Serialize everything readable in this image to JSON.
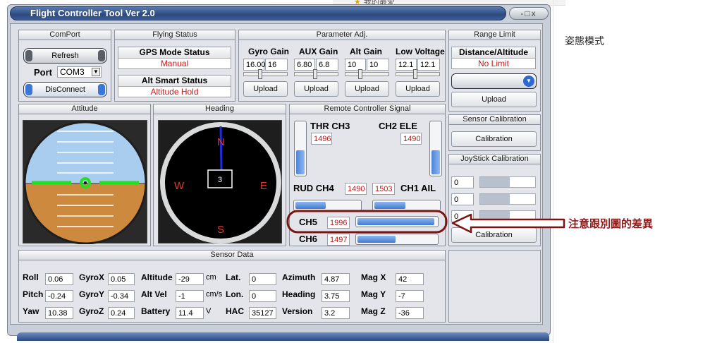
{
  "window": {
    "title": "Flight Controller Tool  Ver 2.0",
    "controls": "-□x"
  },
  "comport": {
    "header": "ComPort",
    "refresh_label": "Refresh",
    "port_label": "Port",
    "port_value": "COM3",
    "disconnect_label": "DisConnect"
  },
  "flying_status": {
    "header": "Flying Status",
    "gps_title": "GPS Mode Status",
    "gps_value": "Manual",
    "alt_title": "Alt Smart Status",
    "alt_value": "Altitude Hold"
  },
  "param": {
    "header": "Parameter Adj.",
    "groups": [
      {
        "label": "Gyro Gain",
        "v1": "16.00",
        "v2": "16",
        "upload": "Upload"
      },
      {
        "label": "AUX Gain",
        "v1": "6.80",
        "v2": "6.8",
        "upload": "Upload"
      },
      {
        "label": "Alt Gain",
        "v1": "10",
        "v2": "10",
        "upload": "Upload"
      },
      {
        "label": "Low Voltage",
        "v1": "12.1",
        "v2": "12.1",
        "upload": "Upload"
      }
    ]
  },
  "range": {
    "header": "Range Limit",
    "title": "Distance/Altitude",
    "value": "No Limit",
    "upload": "Upload"
  },
  "attitude": {
    "header": "Attitude"
  },
  "heading": {
    "header": "Heading",
    "n": "N",
    "e": "E",
    "s": "S",
    "w": "W",
    "value": "3"
  },
  "rc": {
    "header": "Remote Controller Signal",
    "thr_label": "THR CH3",
    "thr_value": "1496",
    "thr_level": 0.5,
    "ele_label": "CH2 ELE",
    "ele_value": "1490",
    "ele_level": 0.49,
    "rud_label": "RUD CH4",
    "rud_value": "1490",
    "rud_level": 0.49,
    "ail_label": "CH1 AIL",
    "ail_value": "1503",
    "ail_level": 0.5,
    "ch5_label": "CH5",
    "ch5_value": "1996",
    "ch5_level": 0.97,
    "ch6_label": "CH6",
    "ch6_value": "1497",
    "ch6_level": 0.5
  },
  "sensor_cal": {
    "header": "Sensor Calibration",
    "button": "Calibration"
  },
  "joystick_cal": {
    "header": "JoyStick Calibration",
    "rows": [
      {
        "value": "0"
      },
      {
        "value": "0"
      },
      {
        "value": "0"
      }
    ],
    "button": "Calibration"
  },
  "sensor_data": {
    "header": "Sensor Data",
    "roll_label": "Roll",
    "roll": "0.06",
    "pitch_label": "Pitch",
    "pitch": "-0.24",
    "yaw_label": "Yaw",
    "yaw": "10.38",
    "gyrox_label": "GyroX",
    "gyrox": "0.05",
    "gyroy_label": "GyroY",
    "gyroy": "-0.34",
    "gyroz_label": "GyroZ",
    "gyroz": "0.24",
    "altitude_label": "Altitude",
    "altitude": "-29",
    "altitude_unit": "cm",
    "altvel_label": "Alt Vel",
    "altvel": "-1",
    "altvel_unit": "cm/s",
    "battery_label": "Battery",
    "battery": "11.4",
    "battery_unit": "V",
    "lat_label": "Lat.",
    "lat": "0",
    "lon_label": "Lon.",
    "lon": "0",
    "hac_label": "HAC",
    "hac": "35127",
    "azimuth_label": "Azimuth",
    "azimuth": "4.87",
    "heading_label": "Heading",
    "heading": "3.75",
    "version_label": "Version",
    "version": "3.2",
    "magx_label": "Mag X",
    "magx": "42",
    "magy_label": "Mag Y",
    "magy": "-7",
    "magz_label": "Mag Z",
    "magz": "-36"
  },
  "desktop": {
    "top_text": "我的最愛",
    "side_text": "姿態模式",
    "annotation": "注意跟別圖的差異",
    "annotation_color": "#8e1a1a"
  }
}
